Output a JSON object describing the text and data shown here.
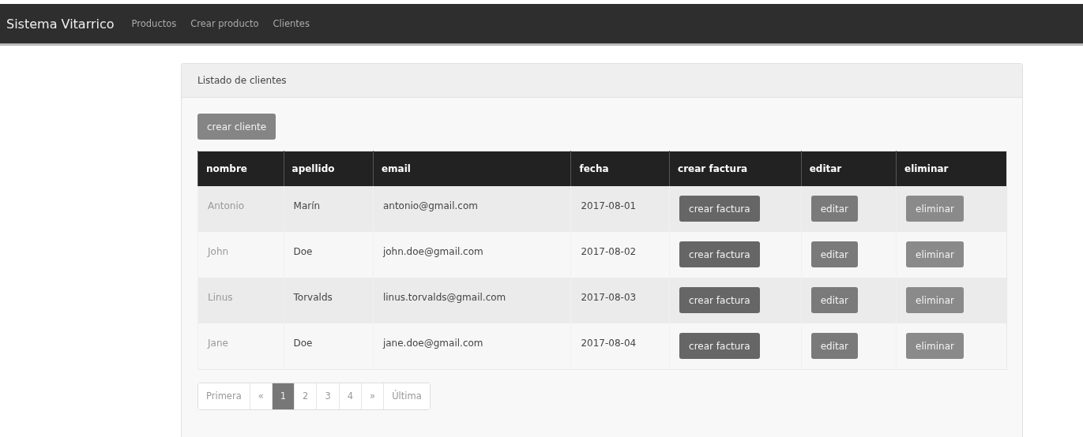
{
  "navbar": {
    "brand": "Sistema Vitarrico",
    "links": [
      "Productos",
      "Crear producto",
      "Clientes"
    ]
  },
  "panel": {
    "title": "Listado de clientes",
    "create_button": "crear cliente",
    "table": {
      "columns": [
        "nombre",
        "apellido",
        "email",
        "fecha",
        "crear factura",
        "editar",
        "eliminar"
      ],
      "rows": [
        {
          "cells": [
            "Antonio",
            "Marín",
            "antonio@gmail.com",
            "2017-08-01"
          ],
          "actions": [
            {
              "kind": "invoice",
              "label": "crear factura"
            },
            {
              "kind": "edit",
              "label": "editar"
            },
            {
              "kind": "delete",
              "label": "eliminar"
            }
          ]
        },
        {
          "cells": [
            "John",
            "Doe",
            "john.doe@gmail.com",
            "2017-08-02"
          ],
          "actions": [
            {
              "kind": "invoice",
              "label": "crear factura"
            },
            {
              "kind": "edit",
              "label": "editar"
            },
            {
              "kind": "delete",
              "label": "eliminar"
            }
          ]
        },
        {
          "cells": [
            "Linus",
            "Torvalds",
            "linus.torvalds@gmail.com",
            "2017-08-03"
          ],
          "actions": [
            {
              "kind": "invoice",
              "label": "crear factura"
            },
            {
              "kind": "edit",
              "label": "editar"
            },
            {
              "kind": "delete",
              "label": "eliminar"
            }
          ]
        },
        {
          "cells": [
            "Jane",
            "Doe",
            "jane.doe@gmail.com",
            "2017-08-04"
          ],
          "actions": [
            {
              "kind": "invoice",
              "label": "crear factura"
            },
            {
              "kind": "edit",
              "label": "editar"
            },
            {
              "kind": "delete",
              "label": "eliminar"
            }
          ]
        }
      ]
    },
    "pagination": [
      {
        "label": "Primera",
        "selected": false
      },
      {
        "label": "«",
        "selected": false
      },
      {
        "label": "1",
        "selected": true
      },
      {
        "label": "2",
        "selected": false
      },
      {
        "label": "3",
        "selected": false
      },
      {
        "label": "4",
        "selected": false
      },
      {
        "label": "»",
        "selected": false
      },
      {
        "label": "Última",
        "selected": false
      }
    ]
  }
}
